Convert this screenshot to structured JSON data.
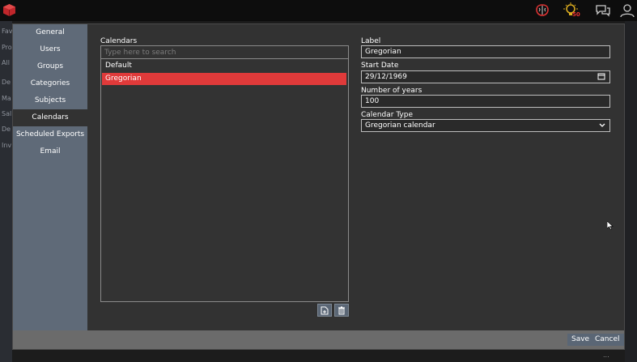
{
  "background": {
    "sidebar_items": [
      "Fav",
      "Pro",
      "All",
      "De",
      "Ma",
      "Sal",
      "De",
      "Inv"
    ],
    "notification_count": "50",
    "bottom_dots": "..."
  },
  "nav": {
    "items": [
      {
        "label": "General"
      },
      {
        "label": "Users"
      },
      {
        "label": "Groups"
      },
      {
        "label": "Categories"
      },
      {
        "label": "Subjects"
      },
      {
        "label": "Calendars"
      },
      {
        "label": "Scheduled Exports"
      },
      {
        "label": "Email"
      }
    ],
    "active": "Calendars"
  },
  "calendars": {
    "heading": "Calendars",
    "search_placeholder": "Type here to search",
    "items": [
      {
        "label": "Default"
      },
      {
        "label": "Gregorian"
      }
    ],
    "selected": "Gregorian"
  },
  "form": {
    "label_label": "Label",
    "label_value": "Gregorian",
    "start_date_label": "Start Date",
    "start_date_value": "29/12/1969",
    "years_label": "Number of years",
    "years_value": "100",
    "type_label": "Calendar Type",
    "type_value": "Gregorian calendar"
  },
  "footer": {
    "save_label": "Save",
    "cancel_label": "Cancel"
  },
  "colors": {
    "accent": "#e03a3a",
    "nav_bg": "#5f6a78",
    "dialog_bg": "#323232",
    "footer_bg": "#6b6b6b",
    "button_bg": "#5a6675"
  },
  "icons": {
    "app": "cube-logo-icon",
    "brain": "brain-icon",
    "bulb": "lightbulb-icon",
    "chat": "chat-icon",
    "user": "user-icon",
    "add": "add-document-icon",
    "delete": "trash-icon",
    "calendar": "calendar-icon",
    "dropdown": "chevron-down-icon"
  }
}
